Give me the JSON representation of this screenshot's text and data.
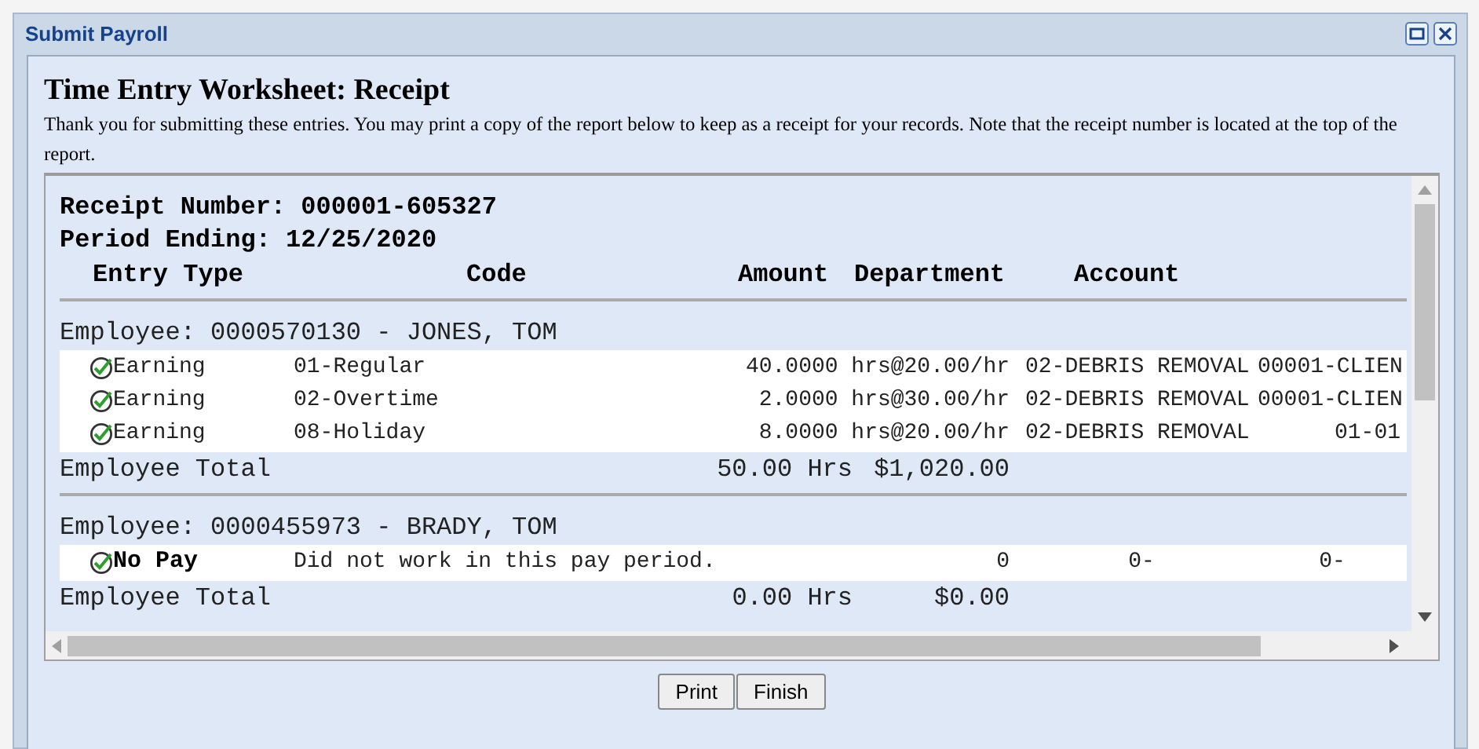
{
  "window": {
    "title": "Submit Payroll"
  },
  "heading": "Time Entry Worksheet: Receipt",
  "message": "Thank you for submitting these entries. You may print a copy of the report below to keep as a receipt for your records. Note that the receipt number is located at the top of the report.",
  "receipt": {
    "receipt_number": "Receipt Number: 000001-605327",
    "period_ending": "Period Ending: 12/25/2020",
    "columns": [
      "Entry Type",
      "Code",
      "Amount",
      "Department",
      "Account"
    ],
    "employees": [
      {
        "header": "Employee: 0000570130 - JONES, TOM",
        "entries": [
          {
            "kind": "earning",
            "entry_type": "Earning",
            "code": "01-Regular",
            "amount": "40.0000 hrs@20.00/hr",
            "department": "02-DEBRIS REMOVAL",
            "account": "00001-CLIEN"
          },
          {
            "kind": "earning",
            "entry_type": "Earning",
            "code": "02-Overtime",
            "amount": "2.0000 hrs@30.00/hr",
            "department": "02-DEBRIS REMOVAL",
            "account": "00001-CLIEN"
          },
          {
            "kind": "earning",
            "entry_type": "Earning",
            "code": "08-Holiday",
            "amount": "8.0000 hrs@20.00/hr",
            "department": "02-DEBRIS REMOVAL",
            "account": "01-01"
          }
        ],
        "total": {
          "label": "Employee Total",
          "hours": "50.00 Hrs",
          "amount": "$1,020.00"
        }
      },
      {
        "header": "Employee: 0000455973 - BRADY, TOM",
        "entries": [
          {
            "kind": "no_pay",
            "entry_type": "No Pay",
            "code": "Did not work in this pay period.",
            "amount": "0",
            "department": "0-",
            "account": "0-"
          }
        ],
        "total": {
          "label": "Employee Total",
          "hours": "0.00 Hrs",
          "amount": "$0.00"
        }
      }
    ]
  },
  "buttons": [
    "Print",
    "Finish"
  ]
}
